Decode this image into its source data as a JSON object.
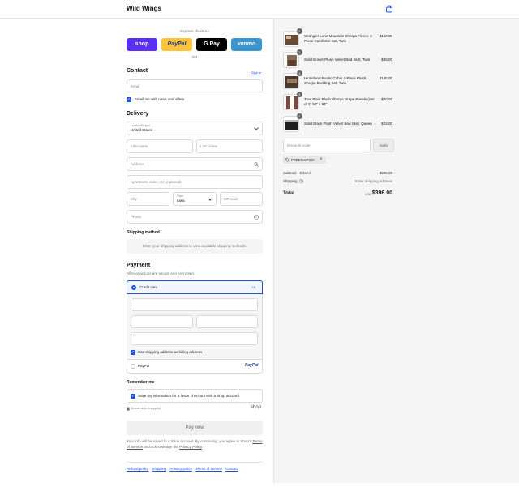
{
  "header": {
    "brand": "Wild Wings",
    "cart_icon": "shopping-bag-icon"
  },
  "express": {
    "label": "Express checkout",
    "buttons": [
      {
        "label": "shop",
        "color": "#5a31f4"
      },
      {
        "label": "PayPal",
        "color": "#ffc439"
      },
      {
        "label": "G Pay",
        "color": "#000000"
      },
      {
        "label": "venmo",
        "color": "#3d95ce"
      }
    ],
    "or": "OR"
  },
  "contact": {
    "title": "Contact",
    "sign_in": "Sign in",
    "email_placeholder": "Email",
    "newsletter": "Email me with news and offers"
  },
  "delivery": {
    "title": "Delivery",
    "country_label": "Country/Region",
    "country_value": "United States",
    "first_name": "First name",
    "last_name": "Last name",
    "address": "Address",
    "apartment": "Apartment, suite, etc. (optional)",
    "city": "City",
    "state_label": "State",
    "state_value": "Iowa",
    "zip": "ZIP code",
    "phone": "Phone"
  },
  "shipping_method": {
    "title": "Shipping method",
    "message": "Enter your shipping address to view available shipping methods."
  },
  "payment": {
    "title": "Payment",
    "subtitle": "All transactions are secure and encrypted.",
    "credit_card": "Credit card",
    "more": "+5",
    "billing_same": "Use shipping address as billing address",
    "paypal": "PayPal",
    "paypal_logo": "PayPal"
  },
  "remember": {
    "title": "Remember me",
    "save_info": "Save my information for a faster checkout with a Shop account",
    "secure": "Secure and encrypted",
    "shop_logo": "shop"
  },
  "pay_now": "Pay now",
  "legal": {
    "text_1": "Your info will be saved to a Shop account. By continuing, you agree to Shop's",
    "terms": "Terms of Service",
    "text_2": "and acknowledge the",
    "privacy": "Privacy Policy",
    "text_3": "."
  },
  "footer_links": [
    "Refund policy",
    "Shipping",
    "Privacy policy",
    "Terms of service",
    "Contact"
  ],
  "order": {
    "items": [
      {
        "qty": "1",
        "name": "Wrangler Lone Mountain Sherpa Fleece 3-Piece Comforter Set, Twin",
        "price": "$108.00"
      },
      {
        "qty": "1",
        "name": "Solid Brown Plush Velvet Bed Skirt, Twin",
        "price": "$36.00"
      },
      {
        "qty": "1",
        "name": "Hinterland Rustic Cabin 4-Piece Plush Sherpa Bedding Set, Twin",
        "price": "$140.00"
      },
      {
        "qty": "1",
        "name": "Tree Plaid Plush Sherpa Drape Panels (Set of 2) 54\" x 84\"",
        "price": "$70.00"
      },
      {
        "qty": "1",
        "name": "Solid Black Plush Velvet Bed Skirt, Queen",
        "price": "$42.00"
      }
    ],
    "discount_placeholder": "Discount code",
    "apply": "Apply",
    "code": "FREESHIP300",
    "subtotal_label": "Subtotal · 5 items",
    "subtotal_value": "$396.00",
    "shipping_label": "Shipping",
    "shipping_value": "Enter shipping address",
    "total_label": "Total",
    "currency": "USD",
    "total_value": "$396.00"
  }
}
